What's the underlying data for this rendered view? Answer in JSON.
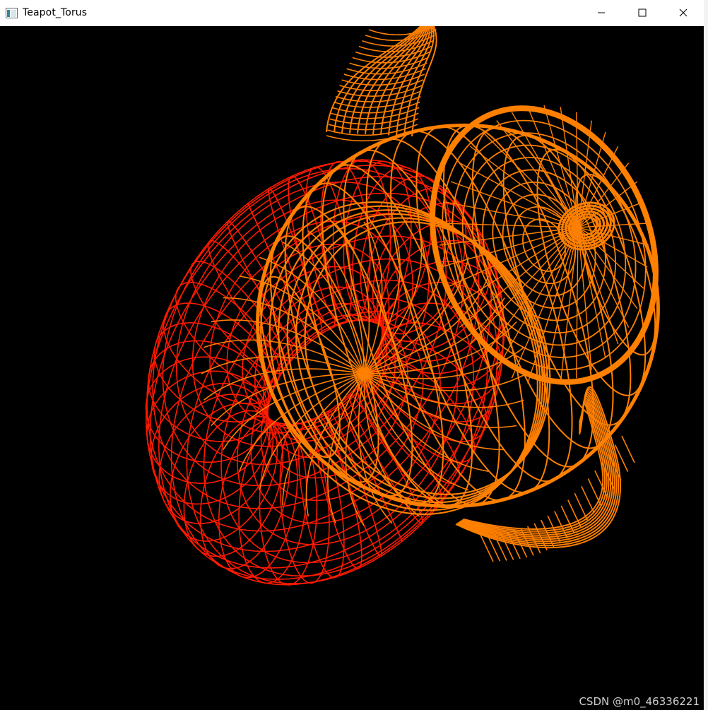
{
  "window": {
    "title": "Teapot_Torus",
    "app_icon": "app-window-icon",
    "controls": {
      "minimize_icon": "minimize-icon",
      "maximize_icon": "maximize-icon",
      "close_icon": "close-icon"
    }
  },
  "scene": {
    "background_color": "#000000",
    "torus_color": "#ff1a00",
    "teapot_color": "#ff8000"
  },
  "watermark": "CSDN @m0_46336221"
}
